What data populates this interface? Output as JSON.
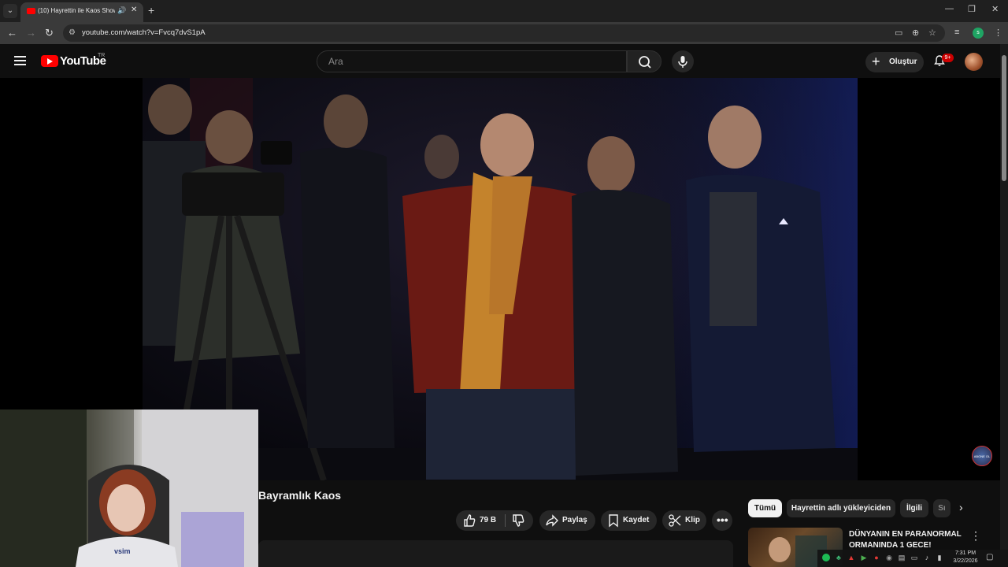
{
  "browser": {
    "tab_title": "(10) Hayrettin ile Kaos Show",
    "tab_audio_icon": "speaker-icon",
    "url": "youtube.com/watch?v=Fvcq7dvS1pA",
    "profile_initial": "s"
  },
  "youtube": {
    "wordmark": "YouTube",
    "region": "TR",
    "search_placeholder": "Ara",
    "create_label": "Oluştur",
    "notifications_badge": "9+",
    "brand_color": "#ff0000"
  },
  "video": {
    "title": "Bayramlık Kaos",
    "like_count": "79 B",
    "share_label": "Paylaş",
    "save_label": "Kaydet",
    "clip_label": "Klip",
    "watermark_text": "ABONE OL"
  },
  "sidebar": {
    "chips": [
      "Tümü",
      "Hayrettin adlı yükleyiciden",
      "İlgili",
      "Sı"
    ],
    "recommendation": {
      "title": "DÜNYANIN EN PARANORMAL ORMANINDA 1 GECE!"
    }
  },
  "taskbar": {
    "time": "7:31 PM",
    "date": "3/22/2026"
  }
}
